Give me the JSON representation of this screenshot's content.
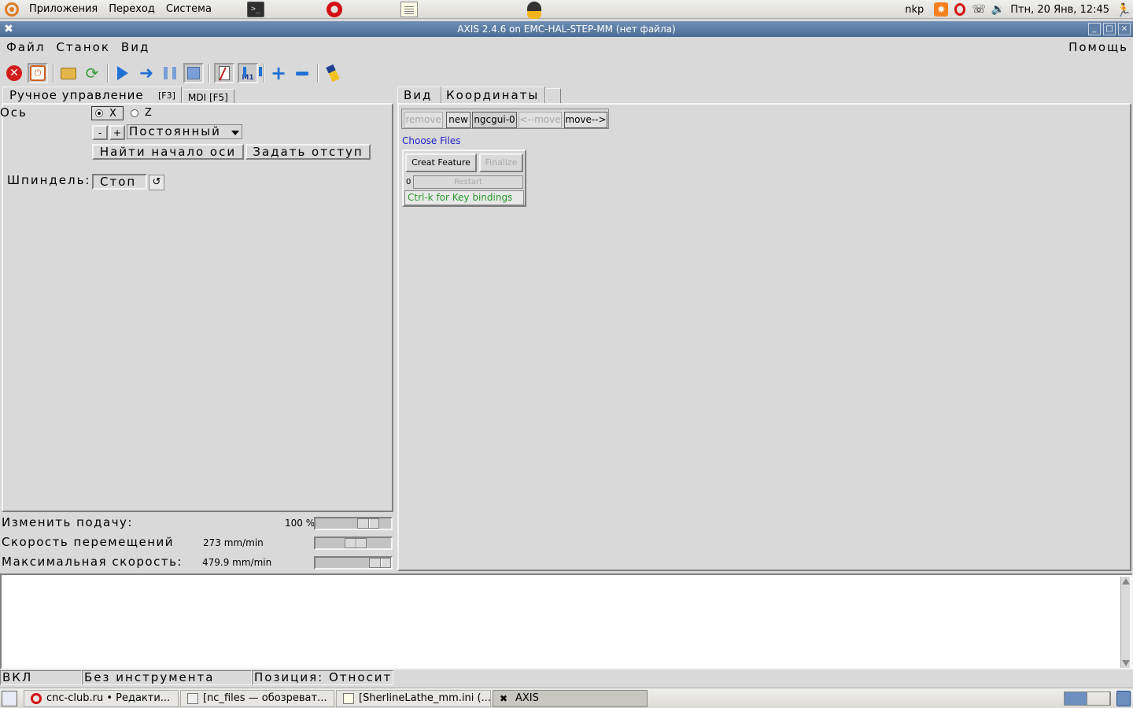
{
  "top_panel": {
    "menus": [
      "Приложения",
      "Переход",
      "Система"
    ],
    "user": "nkp",
    "clock": "Птн, 20 Янв, 12:45"
  },
  "window": {
    "title": "AXIS 2.4.6 on EMC-HAL-STEP-MM (нет файла)"
  },
  "menubar": {
    "file": "Файл",
    "machine": "Станок",
    "view": "Вид",
    "help": "Помощь"
  },
  "left_tabs": {
    "manual_label": "Ручное управление",
    "manual_key": "[F3]",
    "mdi_label": "MDI [F5]"
  },
  "manual": {
    "axis_label": "Ось",
    "axis_x": "X",
    "axis_z": "Z",
    "selected_axis": "X",
    "jog_minus": "-",
    "jog_plus": "+",
    "jog_mode": "Постоянный",
    "home_button": "Найти начало оси",
    "offset_button": "Задать отступ",
    "spindle_label": "Шпиндель:",
    "spindle_state": "Стоп"
  },
  "sliders": {
    "feed_label": "Изменить подачу:",
    "feed_value": "100 %",
    "feed_fraction": 0.78,
    "jog_label": "Скорость перемещений",
    "jog_value": "273 mm/min",
    "jog_fraction": 0.55,
    "max_label": "Максимальная скорость:",
    "max_value": "479.9 mm/min",
    "max_fraction": 1.0
  },
  "right_tabs": {
    "view": "Вид",
    "coords": "Координаты"
  },
  "ngcgui": {
    "remove": "remove",
    "new": "new",
    "current_tab": "ngcgui-0",
    "move_left": "<--move",
    "move_right": "move-->",
    "choose_files": "Choose Files",
    "create_feature": "Creat Feature",
    "finalize": "Finalize",
    "counter": "0",
    "restart": "Restart",
    "key_hint": "Ctrl-k for Key bindings"
  },
  "statusbar": {
    "state": "ВКЛ",
    "tool": "Без инструмента",
    "position": "Позиция: Относите"
  },
  "taskbar": {
    "tasks": [
      "cnc-club.ru • Редакти...",
      "[nc_files — обозреват...",
      "[SherlineLathe_mm.ini (...",
      "AXIS"
    ]
  },
  "colors": {
    "titlebar": "#4a6c97",
    "widget_bg": "#d9d9d9",
    "link": "#1f1fcf",
    "hint_text": "#2a9a2a"
  }
}
